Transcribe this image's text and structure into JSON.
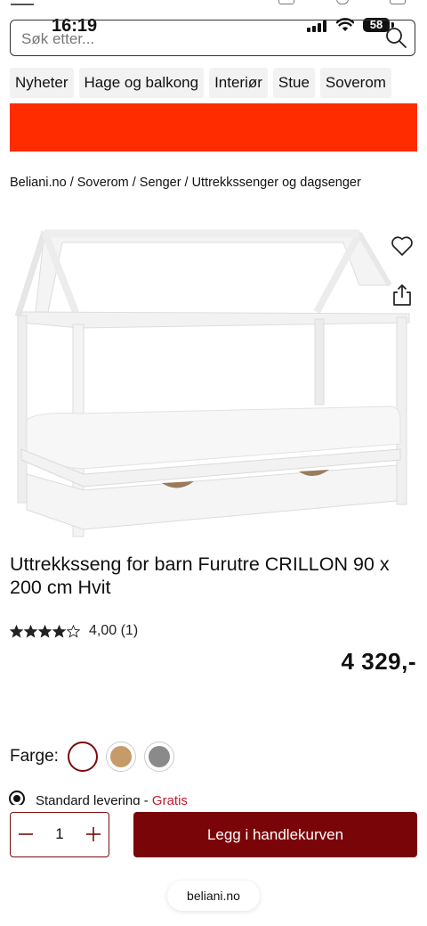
{
  "status_bar": {
    "time": "16:19",
    "battery": "58"
  },
  "search": {
    "placeholder": "Søk etter..."
  },
  "categories": [
    "Nyheter",
    "Hage og balkong",
    "Interiør",
    "Stue",
    "Soverom"
  ],
  "colors": {
    "banner": "#ff2c00",
    "accent": "#7a0508",
    "free": "#c0182b"
  },
  "breadcrumb": [
    "Beliani.no",
    "Soverom",
    "Senger",
    "Uttrekkssenger og dagsenger"
  ],
  "product": {
    "title": "Uttrekksseng for barn Furutre CRILLON 90 x 200 cm Hvit",
    "rating_value": 4,
    "rating_text": "4,00 (1)",
    "price": "4 329,-"
  },
  "color_picker": {
    "label": "Farge:",
    "options": [
      "white",
      "natural-wood",
      "grey"
    ],
    "selected": "white"
  },
  "delivery": {
    "label": "Standard levering",
    "price": "Gratis"
  },
  "cart": {
    "quantity": "1",
    "add_label": "Legg i handlekurven"
  },
  "browser": {
    "url": "beliani.no"
  }
}
